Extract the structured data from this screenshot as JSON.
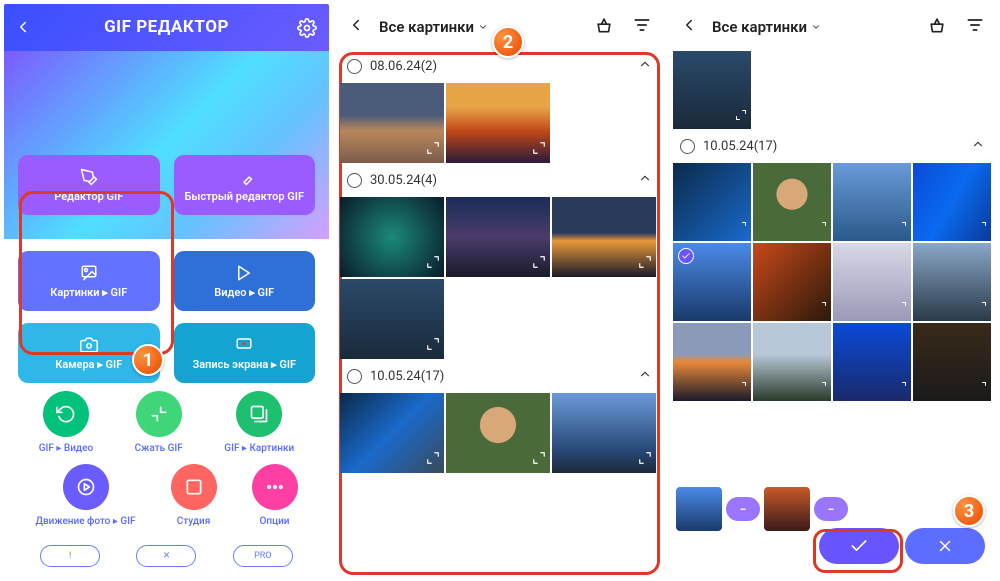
{
  "p1": {
    "title": "GIF РЕДАКТОР",
    "cards": {
      "editor": "Редактор GIF",
      "fast": "Быстрый редактор GIF",
      "pics": "Картинки ▸ GIF",
      "video": "Видео ▸ GIF",
      "camera": "Камера ▸ GIF",
      "screen": "Запись экрана ▸ GIF"
    },
    "circles": {
      "gif2vid": "GIF ▸ Видео",
      "compress": "Сжать GIF",
      "gif2pics": "GIF ▸ Картинки",
      "motion": "Движение фото ▸ GIF",
      "studio": "Студия",
      "options": "Опции"
    },
    "pills": {
      "a": "!",
      "b": "✕",
      "c": "PRO"
    }
  },
  "p2": {
    "title": "Все картинки",
    "groups": [
      {
        "key": "g0",
        "label": "08.06.24(2)"
      },
      {
        "key": "g1",
        "label": "30.05.24(4)"
      },
      {
        "key": "g2",
        "label": "10.05.24(17)"
      }
    ]
  },
  "p3": {
    "title": "Все картинки",
    "groups": [
      {
        "label": "10.05.24(17)"
      }
    ]
  },
  "badges": {
    "b1": "1",
    "b2": "2",
    "b3": "3"
  }
}
